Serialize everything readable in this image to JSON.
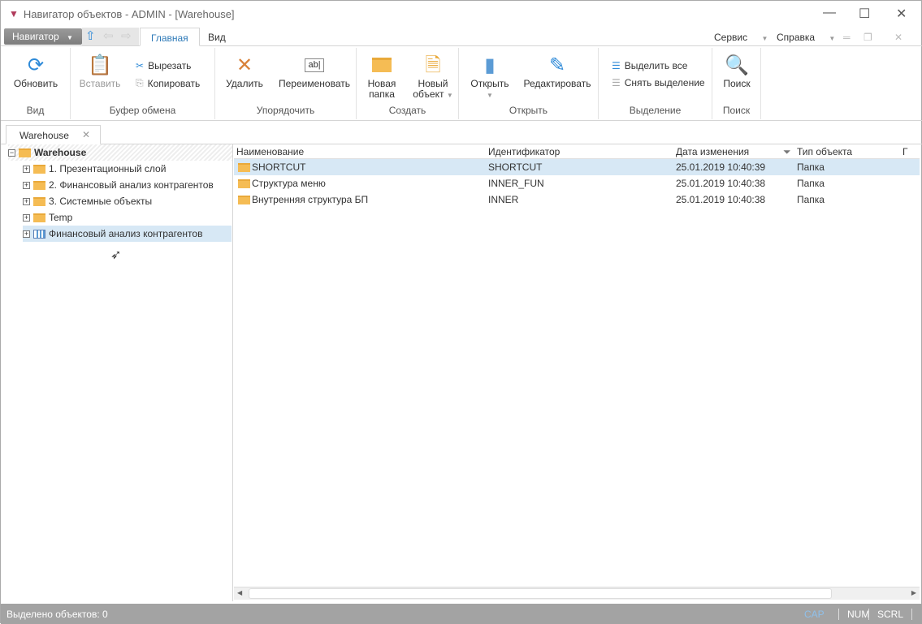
{
  "window": {
    "title": "Навигатор объектов - ADMIN - [Warehouse]"
  },
  "menu": {
    "navigator": "Навигатор",
    "tabs": [
      "Главная",
      "Вид"
    ],
    "service": "Сервис",
    "help": "Справка"
  },
  "ribbon": {
    "groups": [
      "Вид",
      "Буфер обмена",
      "Упорядочить",
      "Создать",
      "Открыть",
      "Выделение",
      "Поиск"
    ],
    "refresh": "Обновить",
    "paste": "Вставить",
    "cut": "Вырезать",
    "copy": "Копировать",
    "delete": "Удалить",
    "rename": "Переименовать",
    "rename_icon": "ab|",
    "new_folder": [
      "Новая",
      "папка"
    ],
    "new_object": [
      "Новый",
      "объект"
    ],
    "open": "Открыть",
    "edit": "Редактировать",
    "select_all": "Выделить все",
    "deselect": "Снять выделение",
    "search": "Поиск"
  },
  "doc_tab": "Warehouse",
  "tree": {
    "root": "Warehouse",
    "items": [
      "1. Презентационный слой",
      "2. Финансовый анализ контрагентов",
      "3. Системные объекты",
      "Temp",
      "Финансовый анализ контрагентов"
    ]
  },
  "grid": {
    "columns": [
      "Наименование",
      "Идентификатор",
      "Дата изменения",
      "Тип объекта",
      "Г"
    ],
    "rows": [
      {
        "name": "SHORTCUT",
        "id": "SHORTCUT",
        "date": "25.01.2019 10:40:39",
        "type": "Папка"
      },
      {
        "name": "Структура меню",
        "id": "INNER_FUN",
        "date": "25.01.2019 10:40:38",
        "type": "Папка"
      },
      {
        "name": "Внутренняя структура БП",
        "id": "INNER",
        "date": "25.01.2019 10:40:38",
        "type": "Папка"
      }
    ]
  },
  "status": {
    "selected": "Выделено объектов: 0",
    "cap": "CAP",
    "num": "NUM",
    "scrl": "SCRL"
  }
}
